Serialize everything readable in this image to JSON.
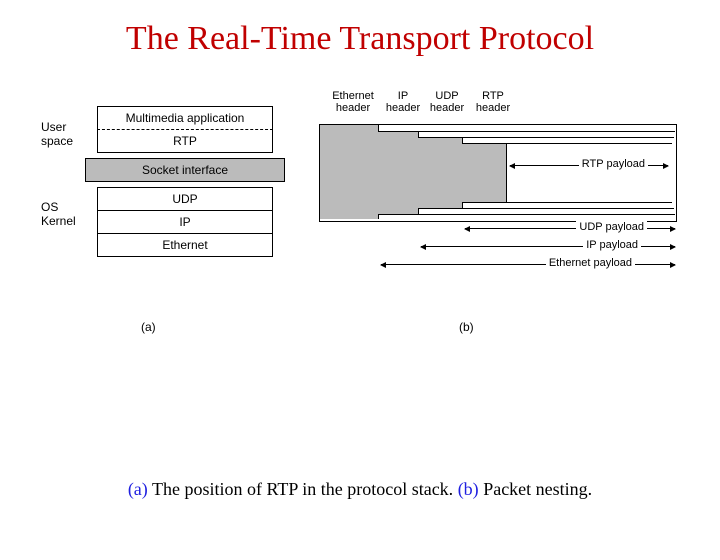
{
  "title": "The Real-Time Transport Protocol",
  "caption": {
    "a_prefix": "(a) ",
    "a_text": "The position of RTP in the protocol stack.  ",
    "b_prefix": "(b) ",
    "b_text": "Packet nesting."
  },
  "panel_a": {
    "sublabel": "(a)",
    "sidelabels": {
      "user_space": "User\nspace",
      "os_kernel": "OS\nKernel"
    },
    "rows": {
      "multimedia": "Multimedia application",
      "rtp": "RTP",
      "socket": "Socket interface",
      "udp": "UDP",
      "ip": "IP",
      "ethernet": "Ethernet"
    }
  },
  "panel_b": {
    "sublabel": "(b)",
    "headers": {
      "eth": "Ethernet\nheader",
      "ip": "IP\nheader",
      "udp": "UDP\nheader",
      "rtp": "RTP\nheader"
    },
    "payloads": {
      "rtp": "RTP payload",
      "udp": "UDP payload",
      "ip": "IP payload",
      "eth": "Ethernet payload"
    }
  }
}
